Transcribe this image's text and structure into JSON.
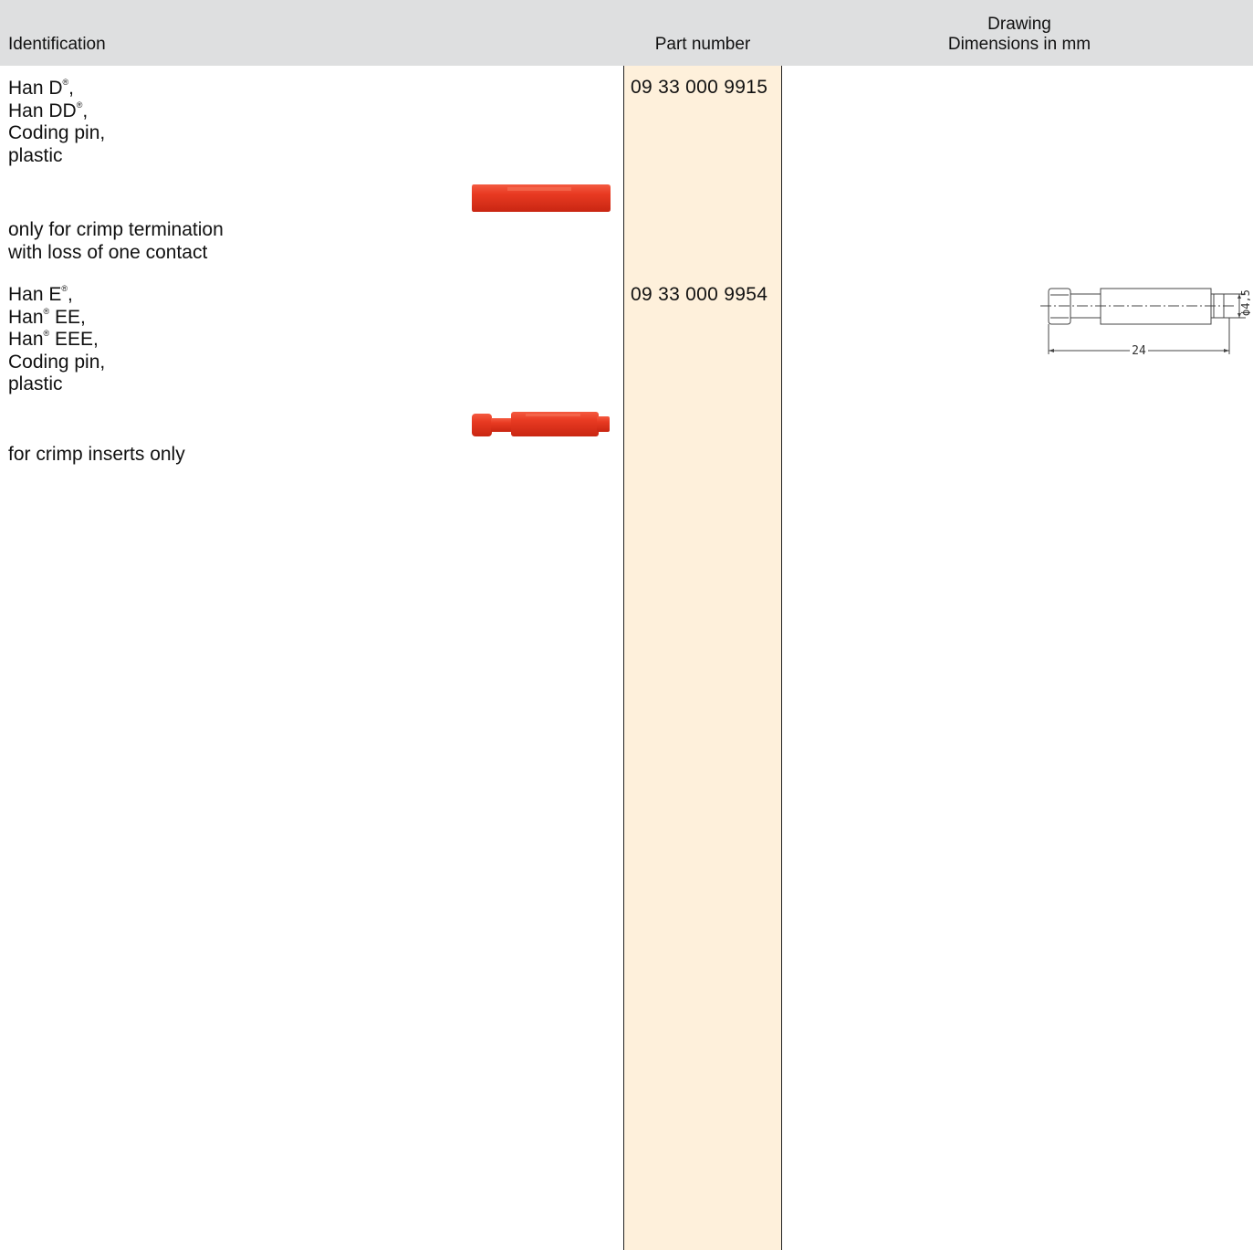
{
  "header": {
    "identification": "Identification",
    "part_number": "Part number",
    "drawing_line1": "Drawing",
    "drawing_line2": "Dimensions in mm"
  },
  "rows": [
    {
      "ident_lines": [
        {
          "pre": "Han D",
          "sup": "®",
          "post": ","
        },
        {
          "pre": "Han DD",
          "sup": "®",
          "post": ","
        },
        {
          "pre": "Coding pin,",
          "sup": "",
          "post": ""
        },
        {
          "pre": "plastic",
          "sup": "",
          "post": ""
        }
      ],
      "note_lines": [
        "only for crimp termination",
        "with loss of one contact"
      ],
      "part_number": "09 33 000 9915",
      "image_icon": "red-coding-pin-image",
      "pin_color": "#e8321f"
    },
    {
      "ident_lines": [
        {
          "pre": "Han E",
          "sup": "®",
          "post": ","
        },
        {
          "pre": "Han",
          "sup": "®",
          "post": " EE,"
        },
        {
          "pre": "Han",
          "sup": "®",
          "post": " EEE,"
        },
        {
          "pre": "Coding pin,",
          "sup": "",
          "post": ""
        },
        {
          "pre": "plastic",
          "sup": "",
          "post": ""
        }
      ],
      "note_lines": [
        "for crimp inserts only"
      ],
      "part_number": "09 33 000 9954",
      "image_icon": "red-stepped-coding-pin-image",
      "pin_color": "#e8321f",
      "drawing": {
        "length_label": "24",
        "diameter_label": "ϕ4,5"
      }
    }
  ]
}
